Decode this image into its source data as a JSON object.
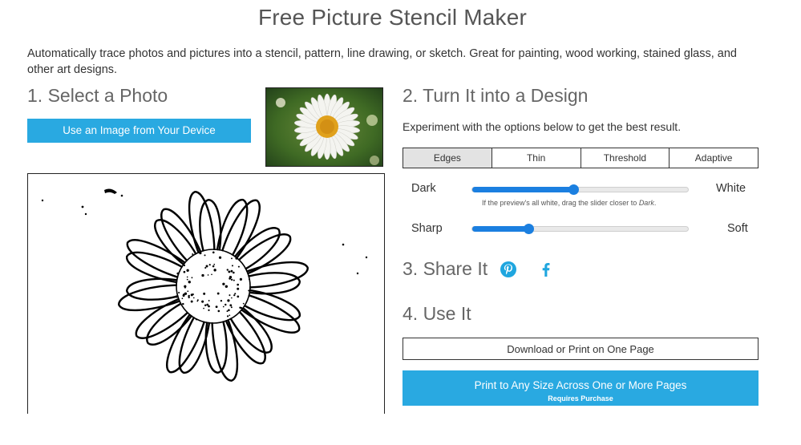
{
  "header": {
    "title": "Free Picture Stencil Maker",
    "intro": "Automatically trace photos and pictures into a stencil, pattern, line drawing, or sketch. Great for painting, wood working, stained glass, and other art designs."
  },
  "step1": {
    "heading": "1. Select a Photo",
    "upload_label": "Use an Image from Your Device"
  },
  "step2": {
    "heading": "2. Turn It into a Design",
    "experiment_text": "Experiment with the options below to get the best result.",
    "tabs": [
      {
        "label": "Edges",
        "active": true
      },
      {
        "label": "Thin",
        "active": false
      },
      {
        "label": "Threshold",
        "active": false
      },
      {
        "label": "Adaptive",
        "active": false
      }
    ],
    "sliders": {
      "darkness": {
        "left_label": "Dark",
        "right_label": "White",
        "value": 0.47
      },
      "hint_prefix": "If the preview's all white, drag the slider closer to ",
      "hint_emphasis": "Dark",
      "hint_suffix": ".",
      "sharpness": {
        "left_label": "Sharp",
        "right_label": "Soft",
        "value": 0.26
      }
    }
  },
  "step3": {
    "heading": "3. Share It",
    "icons": [
      "pinterest-icon",
      "facebook-icon"
    ]
  },
  "step4": {
    "heading": "4. Use It",
    "download_label": "Download or Print on One Page",
    "print_label": "Print to Any Size Across One or More Pages",
    "print_sub": "Requires Purchase"
  },
  "colors": {
    "accent": "#29a9e1",
    "slider": "#1b7fe0",
    "pinterest": "#1fa6df",
    "facebook": "#1fa6df"
  }
}
